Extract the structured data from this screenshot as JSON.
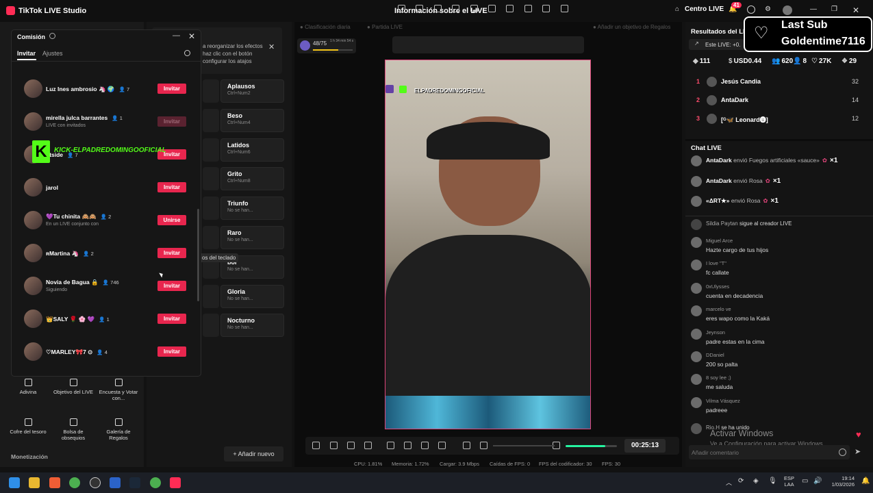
{
  "app": {
    "title": "TikTok LIVE Studio",
    "center_title": "Información sobre el LIVE",
    "centro": "Centro LIVE",
    "notif_count": "41"
  },
  "modal": {
    "title": "Comisión",
    "tab_active": "Invitar",
    "tab_settings": "Ajustes",
    "rows": [
      {
        "name": "Luz Ines ambrosio 🦄 🌍",
        "count": "7",
        "sub": "",
        "button": "Invitar",
        "dim": false
      },
      {
        "name": "mirella julca barrantes",
        "count": "1",
        "sub": "LIVE con invitados",
        "button": "Invitar",
        "dim": true
      },
      {
        "name": "utside",
        "count": "7",
        "sub": "",
        "button": "Invitar",
        "dim": false
      },
      {
        "name": "jarol",
        "count": "",
        "sub": "",
        "button": "Invitar",
        "dim": false
      },
      {
        "name": "💜Tu chinita 🙈🙈",
        "count": "2",
        "sub": "En un LIVE conjunto con",
        "button": "Unirse",
        "dim": false
      },
      {
        "name": "ʀMartina 🦄",
        "count": "2",
        "sub": "",
        "button": "Invitar",
        "dim": false
      },
      {
        "name": "Novia de Bagua 🔒",
        "count": "746",
        "sub": "Siguiendo",
        "button": "Invitar",
        "dim": false
      },
      {
        "name": "👑SALY 🌹 🌸 💜",
        "count": "1",
        "sub": "",
        "button": "Invitar",
        "dim": false
      },
      {
        "name": "♡MARLEY🎀7 ⊙",
        "count": "4",
        "sub": "",
        "button": "Invitar",
        "dim": false
      }
    ],
    "kick_banner": "KICK-ELPADREDOMINGOOFICIAL"
  },
  "tools": [
    {
      "label": "Adivina"
    },
    {
      "label": "Objetivo del LIVE"
    },
    {
      "label": "Encuesta y Votar con..."
    },
    {
      "label": "Cofre del tesoro"
    },
    {
      "label": "Bolsa de obsequios"
    },
    {
      "label": "Galería de Regalos"
    }
  ],
  "monetizacion": "Monetización",
  "effects": {
    "hint": "a reorganizar los efectos haz clic con el botón configurar los atajos",
    "add_new": "Añadir nuevo",
    "tooltip": "os del teclado",
    "cards": [
      {
        "name": "Aplausos",
        "key": "Ctrl+Num2"
      },
      {
        "name": "Beso",
        "key": "Ctrl+Num4"
      },
      {
        "name": "Latidos",
        "key": "Ctrl+Num6"
      },
      {
        "name": "Grito",
        "key": "Ctrl+Num8"
      },
      {
        "name": "Triunfo",
        "key": "No se han..."
      },
      {
        "name": "Raro",
        "key": "No se han..."
      },
      {
        "name": "bor",
        "key": "No se han..."
      },
      {
        "name": "Gloria",
        "key": "No se han..."
      },
      {
        "name": "Nocturno",
        "key": "No se han..."
      }
    ]
  },
  "stage": {
    "clasificacion": "Clasificación diaria",
    "partida": "Partida LIVE",
    "objetivo": "Añadir un objetivo de Regalos",
    "progress_label": "48/75",
    "progress_fraction": 0.64,
    "progress_time": "1 h 34 min 54 s",
    "overlay_name": "ELPADREDOMINGOFICIAL",
    "timer": "00:25:13"
  },
  "status": {
    "cpu": "CPU: 1.81%",
    "mem": "Memoria: 1.72%",
    "load": "Cargar: 3.9 Mbps",
    "fps_drop": "Caídas de FPS: 0",
    "enc_fps": "FPS del codificador: 30",
    "fps": "FPS: 30"
  },
  "results": {
    "title": "Resultados del LI",
    "este": "Este LIVE: +0.",
    "stats": [
      "111",
      "USD0.44",
      "620",
      "8",
      "27K",
      "29"
    ],
    "ranking": [
      {
        "rank": "1",
        "name": "Jesús Candia",
        "score": "32"
      },
      {
        "rank": "2",
        "name": "AntaDark",
        "score": "14"
      },
      {
        "rank": "3",
        "name": "[ᴳ🦋 Leonard🅑]",
        "score": "12"
      }
    ]
  },
  "lastsub": {
    "line1": "Last Sub",
    "line2": "Goldentime7116"
  },
  "chat": {
    "title": "Chat LIVE",
    "gifts": [
      {
        "user": "AntaDark",
        "text": "envió Fuegos artificiales «sauce»",
        "mult": "×1"
      },
      {
        "user": "AntaDark",
        "text": "envió Rosa",
        "mult": "×1"
      },
      {
        "user": "«ΔRT★»",
        "text": "envió Rosa",
        "mult": "×1"
      }
    ],
    "follow": {
      "user": "Sildia Paytan",
      "text": "sigue al creador LIVE"
    },
    "messages": [
      {
        "user": "Miguel Arce",
        "text": "Hazte cargo de tus hijos"
      },
      {
        "user": "I love \"T\"",
        "text": "fc callate"
      },
      {
        "user": "0xUlysses",
        "text": "cuenta en decadencia"
      },
      {
        "user": "marcelo ve",
        "text": "eres wapo como la Kaká"
      },
      {
        "user": "Jeynson",
        "text": "padre estas en la cima"
      },
      {
        "user": "DDaniel",
        "text": "200 so palta"
      },
      {
        "user": "8 soy lee ;)",
        "text": "me saluda"
      },
      {
        "user": "Vilma Vásquez",
        "text": "padreee"
      }
    ],
    "joined": {
      "user": "Rio.H",
      "text": "se ha unido"
    },
    "placeholder": "Añadir comentario",
    "watermark1": "Activar Windows",
    "watermark2": "Ve a Configuración para activar Windows."
  },
  "taskbar": {
    "lang1": "ESP",
    "lang2": "LAA",
    "time": "19:14",
    "date": "1/03/2026"
  }
}
